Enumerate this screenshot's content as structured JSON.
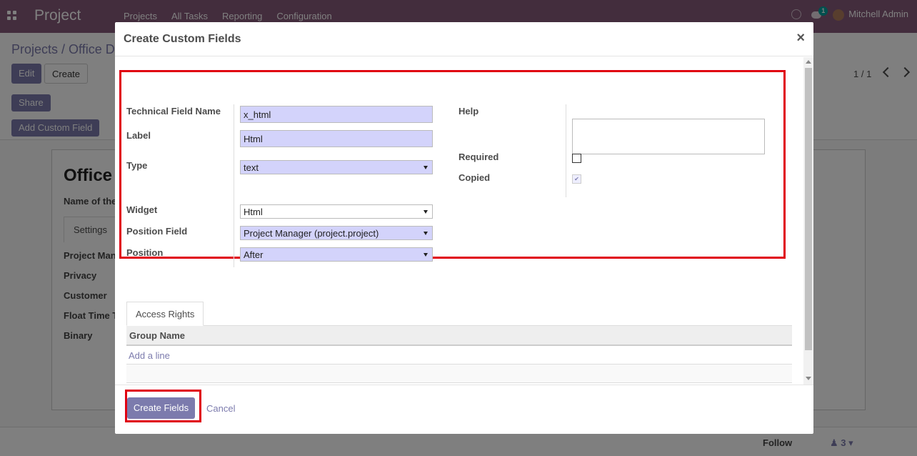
{
  "navbar": {
    "app_name": "Project",
    "menu": [
      "Projects",
      "All Tasks",
      "Reporting",
      "Configuration"
    ],
    "chat_badge": "1",
    "user": "Mitchell Admin"
  },
  "control_panel": {
    "breadcrumb": "Projects / Office D",
    "edit": "Edit",
    "create": "Create",
    "share": "Share",
    "add_custom_field": "Add Custom Field",
    "pager": "1 / 1"
  },
  "form_sheet": {
    "title": "Office",
    "subtitle": "Name of the",
    "tab": "Settings",
    "labels": [
      "Project Man",
      "Privacy",
      "Customer",
      "Float Time T",
      "Binary"
    ]
  },
  "chatter": {
    "follow": "Follow",
    "followers": "3"
  },
  "modal": {
    "title": "Create Custom Fields",
    "close": "×",
    "fields": {
      "technical_name": {
        "label": "Technical Field Name",
        "value": "x_html"
      },
      "label": {
        "label": "Label",
        "value": "Html"
      },
      "type": {
        "label": "Type",
        "value": "text"
      },
      "widget": {
        "label": "Widget",
        "value": "Html"
      },
      "position_field": {
        "label": "Position Field",
        "value": "Project Manager (project.project)"
      },
      "position": {
        "label": "Position",
        "value": "After"
      },
      "help": {
        "label": "Help",
        "value": ""
      },
      "required": {
        "label": "Required"
      },
      "copied": {
        "label": "Copied",
        "checked": "✔"
      }
    },
    "tab_access": "Access Rights",
    "table_header": "Group Name",
    "add_line": "Add a line",
    "create_btn": "Create Fields",
    "cancel_btn": "Cancel"
  }
}
